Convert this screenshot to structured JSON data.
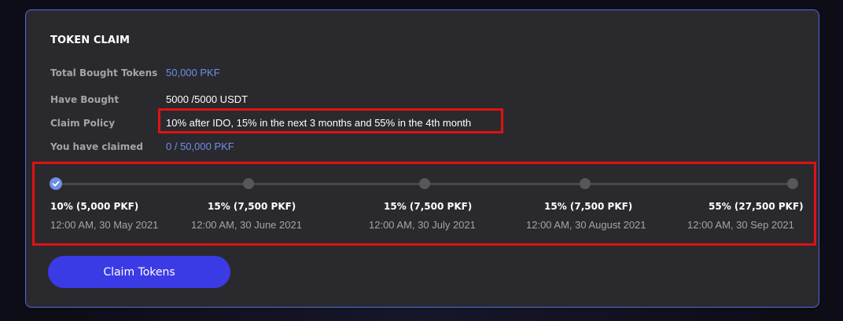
{
  "card": {
    "title": "TOKEN CLAIM"
  },
  "info": {
    "total_bought_label": "Total Bought Tokens",
    "total_bought_value": "50,000 PKF",
    "have_bought_label": "Have Bought",
    "have_bought_value": "5000 /5000 USDT",
    "claim_policy_label": "Claim Policy",
    "claim_policy_value": "10% after IDO, 15% in the next 3 months and 55% in the 4th month",
    "claimed_label": "You have claimed",
    "claimed_value": "0 / 50,000 PKF"
  },
  "milestones": [
    {
      "amount": "10% (5,000 PKF)",
      "date": "12:00 AM, 30 May 2021",
      "completed": true
    },
    {
      "amount": "15% (7,500 PKF)",
      "date": "12:00 AM, 30 June 2021",
      "completed": false
    },
    {
      "amount": "15% (7,500 PKF)",
      "date": "12:00 AM, 30 July 2021",
      "completed": false
    },
    {
      "amount": "15% (7,500 PKF)",
      "date": "12:00 AM, 30 August 2021",
      "completed": false
    },
    {
      "amount": "55% (27,500 PKF)",
      "date": "12:00 AM, 30 Sep 2021",
      "completed": false
    }
  ],
  "actions": {
    "claim_label": "Claim Tokens"
  },
  "colors": {
    "accent_blue": "#6e8fe6",
    "button_blue": "#3b3be6",
    "highlight_red": "#e01212",
    "card_border": "#4d6bd6"
  }
}
